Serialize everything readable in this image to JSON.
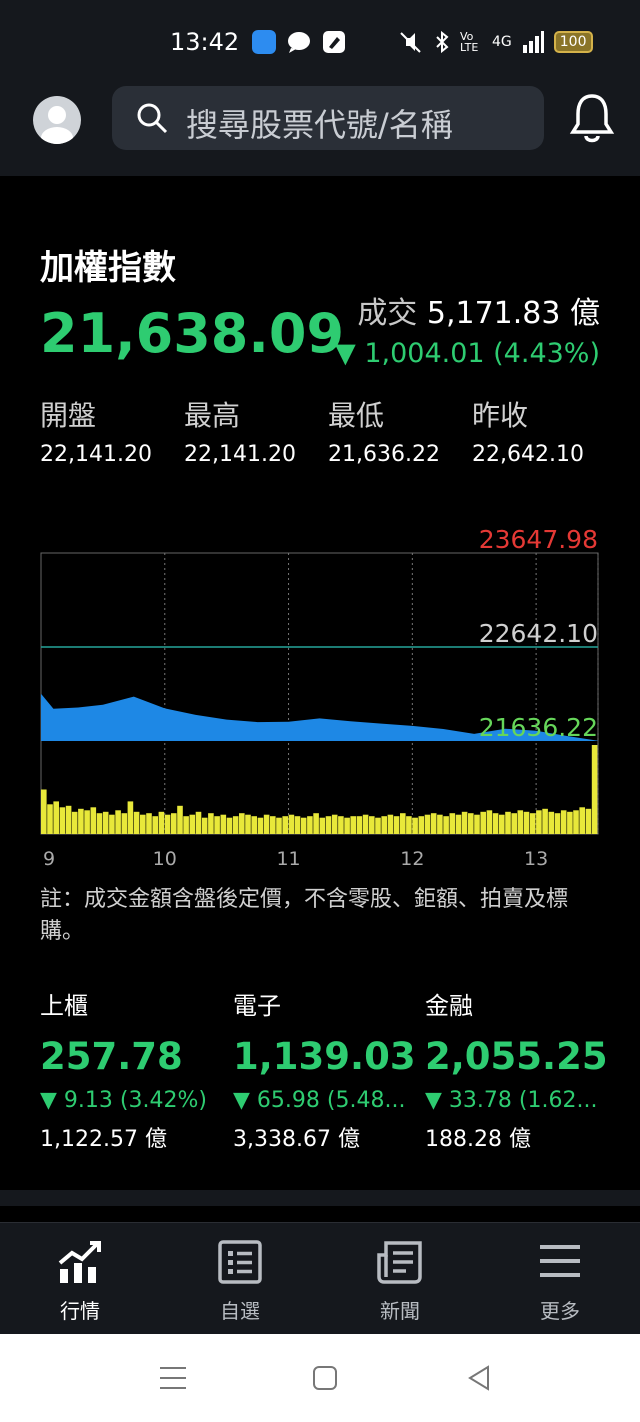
{
  "status_bar": {
    "time": "13:42",
    "battery": "100",
    "network": "4G",
    "volte": "Vo LTE"
  },
  "header": {
    "search_placeholder": "搜尋股票代號/名稱"
  },
  "index": {
    "title": "加權指數",
    "value": "21,638.09",
    "volume_label": "成交",
    "volume_value": "5,171.83 億",
    "change": "▼ 1,004.01 (4.43%)",
    "ohlc": [
      {
        "label": "開盤",
        "value": "22,141.20"
      },
      {
        "label": "最高",
        "value": "22,141.20"
      },
      {
        "label": "最低",
        "value": "21,636.22"
      },
      {
        "label": "昨收",
        "value": "22,642.10"
      }
    ]
  },
  "chart_data": {
    "type": "area",
    "title": "",
    "x_ticks": [
      "9",
      "10",
      "11",
      "12",
      "13"
    ],
    "y_labels": {
      "high_limit": "23647.98",
      "prev_close": "22642.10",
      "low": "21636.22"
    },
    "ylim": [
      21636.22,
      23647.98
    ],
    "series": [
      {
        "x": [
          9.0,
          9.1,
          9.3,
          9.5,
          9.75,
          10.0,
          10.25,
          10.5,
          10.75,
          11.0,
          11.25,
          11.5,
          11.75,
          12.0,
          12.25,
          12.5,
          12.75,
          13.0,
          13.25,
          13.5
        ],
        "values": [
          22141.2,
          21981.0,
          21995.0,
          22025.0,
          22111.0,
          21985.0,
          21915.0,
          21865.0,
          21838.0,
          21842.0,
          21878.0,
          21848.0,
          21822.0,
          21798.0,
          21765.0,
          21712.0,
          21768.0,
          21745.0,
          21690.0,
          21638.09
        ]
      }
    ],
    "volume_bars": [
      30,
      20,
      22,
      18,
      19,
      15,
      17,
      16,
      18,
      14,
      15,
      13,
      16,
      14,
      22,
      15,
      13,
      14,
      12,
      15,
      13,
      14,
      19,
      12,
      13,
      15,
      11,
      14,
      12,
      13,
      11,
      12,
      14,
      13,
      12,
      11,
      13,
      12,
      11,
      12,
      13,
      12,
      11,
      12,
      14,
      11,
      12,
      13,
      12,
      11,
      12,
      12,
      13,
      12,
      11,
      12,
      13,
      12,
      14,
      12,
      11,
      12,
      13,
      14,
      13,
      12,
      14,
      13,
      15,
      14,
      13,
      15,
      16,
      14,
      13,
      15,
      14,
      16,
      15,
      14,
      16,
      17,
      15,
      14,
      16,
      15,
      16,
      18,
      17,
      60
    ],
    "grid": true,
    "colors": {
      "area": "#1e88e5",
      "volume": "#e8e83a",
      "prev_close_line": "#26a69a",
      "high_label": "#e53935",
      "low_label": "#66d65a"
    }
  },
  "note": "註：成交金額含盤後定價，不含零股、鉅額、拍賣及標購。",
  "sub_indices": [
    {
      "name": "上櫃",
      "value": "257.78",
      "change": "▼ 9.13 (3.42%)",
      "volume": "1,122.57 億"
    },
    {
      "name": "電子",
      "value": "1,139.03",
      "change": "▼ 65.98 (5.48...",
      "volume": "3,338.67 億"
    },
    {
      "name": "金融",
      "value": "2,055.25",
      "change": "▼ 33.78 (1.62...",
      "volume": "188.28 億"
    }
  ],
  "bottom_nav": [
    {
      "label": "行情",
      "icon": "market-chart-icon",
      "active": true
    },
    {
      "label": "自選",
      "icon": "watchlist-icon",
      "active": false
    },
    {
      "label": "新聞",
      "icon": "news-icon",
      "active": false
    },
    {
      "label": "更多",
      "icon": "menu-icon",
      "active": false
    }
  ],
  "colors": {
    "up_down_green": "#2ecc71",
    "background": "#000000",
    "bar_background": "#15181d"
  }
}
